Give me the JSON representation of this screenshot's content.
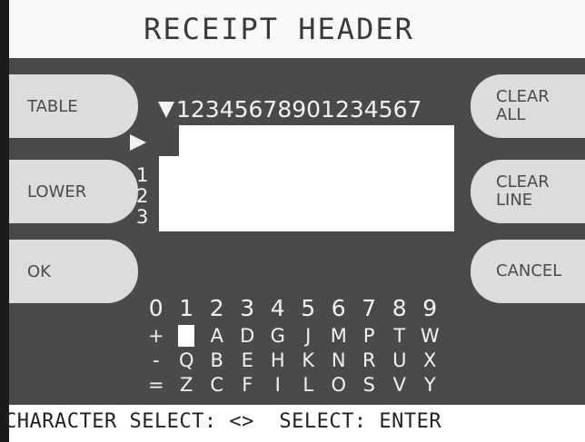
{
  "screen": {
    "title": "RECEIPT HEADER"
  },
  "softkeys": {
    "left": [
      {
        "label": "TABLE"
      },
      {
        "label": "LOWER"
      },
      {
        "label": "OK"
      }
    ],
    "right": [
      {
        "label": "CLEAR\nALL"
      },
      {
        "label": "CLEAR\nLINE"
      },
      {
        "label": "CANCEL"
      }
    ]
  },
  "editor": {
    "column_ruler": "12345678901234567",
    "line_numbers": [
      "1",
      "2",
      "3"
    ]
  },
  "character_map": {
    "digits": [
      "0",
      "1",
      "2",
      "3",
      "4",
      "5",
      "6",
      "7",
      "8",
      "9"
    ],
    "rows": [
      [
        "+",
        "",
        "A",
        "D",
        "G",
        "J",
        "M",
        "P",
        "T",
        "W"
      ],
      [
        "-",
        "Q",
        "B",
        "E",
        "H",
        "K",
        "N",
        "R",
        "U",
        "X"
      ],
      [
        "=",
        "Z",
        "C",
        "F",
        "I",
        "L",
        "O",
        "S",
        "V",
        "Y"
      ]
    ]
  },
  "footer": {
    "hint": "CHARACTER SELECT: <>  SELECT: ENTER"
  },
  "colors": {
    "panel": "#4a4a4a",
    "softkey": "#dcdcdc",
    "text_light": "#f2f2f2"
  }
}
